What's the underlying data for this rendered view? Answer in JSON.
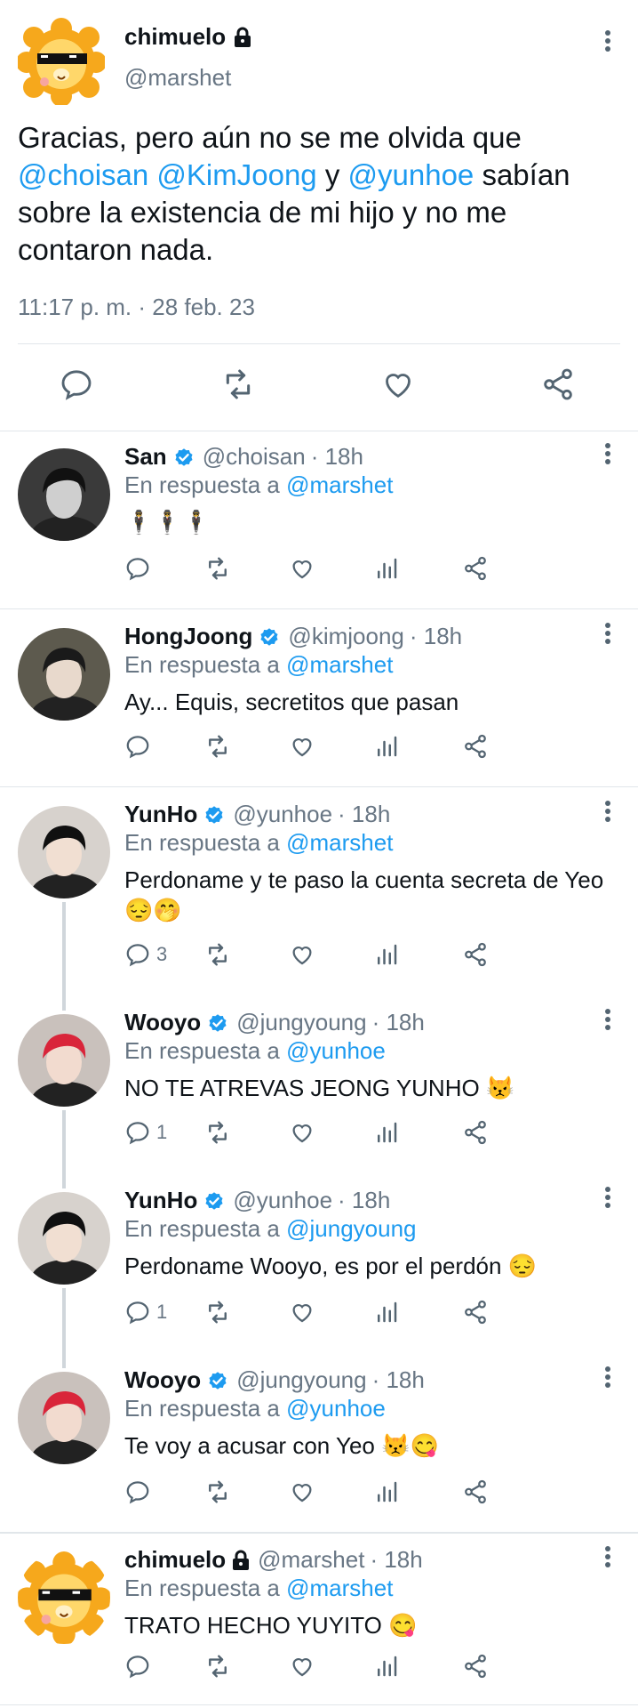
{
  "main_tweet": {
    "name": "chimuelo",
    "handle": "@marshet",
    "text_parts": [
      {
        "text": "Gracias, pero aún no se me olvida que ",
        "link": false
      },
      {
        "text": "@choisan",
        "link": true
      },
      {
        "text": " ",
        "link": false
      },
      {
        "text": "@KimJoong",
        "link": true
      },
      {
        "text": " y ",
        "link": false
      },
      {
        "text": "@yunhoe",
        "link": true
      },
      {
        "text": " sabían sobre la existencia de mi hijo y no me contaron nada.",
        "link": false
      }
    ],
    "timestamp": "11:17 p. m. · 28 feb. 23"
  },
  "in_reply_label": "En respuesta a",
  "replies": [
    {
      "name": "San",
      "verified": true,
      "locked": false,
      "handle": "@choisan",
      "time": "· 18h",
      "reply_to": "@marshet",
      "text": "🕴🕴🕴",
      "replies_count": ""
    },
    {
      "name": "HongJoong",
      "verified": true,
      "locked": false,
      "handle": "@kimjoong",
      "time": "· 18h",
      "reply_to": "@marshet",
      "text": "Ay... Equis, secretitos que pasan",
      "replies_count": ""
    },
    {
      "name": "YunHo",
      "verified": true,
      "locked": false,
      "handle": "@yunhoe",
      "time": "· 18h",
      "reply_to": "@marshet",
      "text": "Perdoname y te paso la cuenta secreta de Yeo 😔🤭",
      "replies_count": "3"
    },
    {
      "name": "Wooyo",
      "verified": true,
      "locked": false,
      "handle": "@jungyoung",
      "time": "· 18h",
      "reply_to": "@yunhoe",
      "text": "NO TE ATREVAS JEONG YUNHO 😾",
      "replies_count": "1"
    },
    {
      "name": "YunHo",
      "verified": true,
      "locked": false,
      "handle": "@yunhoe",
      "time": "· 18h",
      "reply_to": "@jungyoung",
      "text": "Perdoname Wooyo, es por el perdón 😔",
      "replies_count": "1"
    },
    {
      "name": "Wooyo",
      "verified": true,
      "locked": false,
      "handle": "@jungyoung",
      "time": "· 18h",
      "reply_to": "@yunhoe",
      "text": "Te voy a acusar con Yeo 😾😋",
      "replies_count": ""
    },
    {
      "name": "chimuelo",
      "verified": false,
      "locked": true,
      "handle": "@marshet",
      "time": "· 18h",
      "reply_to": "@marshet",
      "text": "TRATO HECHO YUYITO 😋",
      "replies_count": ""
    }
  ],
  "colors": {
    "link": "#1d9bf0",
    "muted": "#687684",
    "verified": "#1d9bf0"
  }
}
